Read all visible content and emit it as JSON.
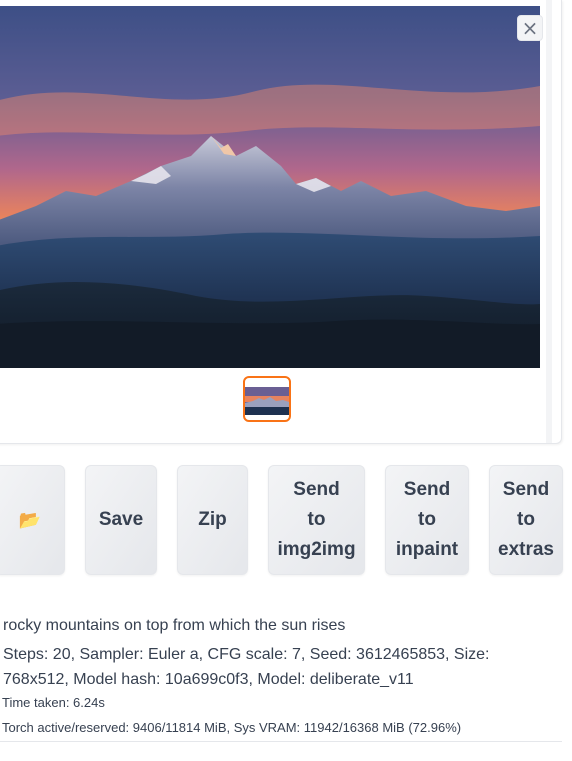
{
  "gallery": {
    "close_label": "×",
    "image_description_icon": "mountain-sunrise-image",
    "thumbnail_selected": true,
    "accent_color": "#f97316"
  },
  "actions": {
    "folder_icon": "📂",
    "save_label": "Save",
    "zip_label": "Zip",
    "send_img2img_lines": [
      "Send",
      "to",
      "img2img"
    ],
    "send_inpaint_lines": [
      "Send",
      "to",
      "inpaint"
    ],
    "send_extras_lines": [
      "Send",
      "to",
      "extras"
    ]
  },
  "info": {
    "prompt": "rocky mountains on top from which the sun rises",
    "params": "Steps: 20, Sampler: Euler a, CFG scale: 7, Seed: 3612465853, Size: 768x512, Model hash: 10a699c0f3, Model: deliberate_v11",
    "time_taken": "Time taken: 6.24s",
    "vram": "Torch active/reserved: 9406/11814 MiB, Sys VRAM: 11942/16368 MiB (72.96%)"
  }
}
